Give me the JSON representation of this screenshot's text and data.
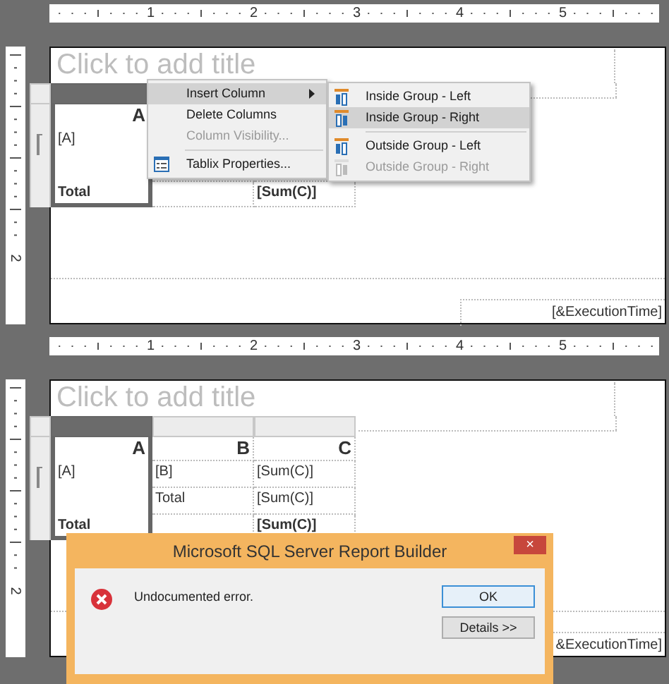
{
  "panels": [
    {
      "ruler": {
        "labels": [
          "1",
          "2",
          "3",
          "4",
          "5"
        ]
      },
      "side_ruler": {
        "labels": [
          "2"
        ]
      },
      "title_placeholder": "Click to add title",
      "tablix": {
        "columns": [
          {
            "kind": "column",
            "selected": true
          },
          {
            "kind": "covered"
          },
          {
            "kind": "covered"
          }
        ],
        "rows": [
          {
            "kind": "header",
            "cells": [
              "A",
              null,
              null
            ]
          },
          {
            "kind": "detail",
            "cells": [
              "[A]",
              null,
              null
            ]
          },
          {
            "kind": "detail",
            "cells": [
              null,
              null,
              null
            ]
          },
          {
            "kind": "total",
            "cells": [
              "Total",
              null,
              "[Sum(C)]"
            ]
          }
        ]
      },
      "footer": "[&ExecutionTime]",
      "context_menu": {
        "items": [
          {
            "kind": "item",
            "label": "Insert Column",
            "selected": true,
            "disabled": false,
            "submenu": true
          },
          {
            "kind": "item",
            "label": "Delete Columns",
            "selected": false,
            "disabled": false,
            "submenu": false
          },
          {
            "kind": "item",
            "label": "Column Visibility...",
            "selected": false,
            "disabled": true,
            "submenu": false
          },
          {
            "kind": "separator"
          },
          {
            "kind": "item",
            "label": "Tablix Properties...",
            "selected": false,
            "disabled": false,
            "submenu": false
          }
        ],
        "submenu": {
          "items": [
            {
              "kind": "item",
              "label": "Inside Group - Left",
              "selected": false,
              "disabled": false
            },
            {
              "kind": "item",
              "label": "Inside Group - Right",
              "selected": true,
              "disabled": false
            },
            {
              "kind": "separator"
            },
            {
              "kind": "item",
              "label": "Outside Group - Left",
              "selected": false,
              "disabled": false
            },
            {
              "kind": "item",
              "label": "Outside Group - Right",
              "selected": false,
              "disabled": true
            }
          ]
        }
      }
    },
    {
      "ruler": {
        "labels": [
          "1",
          "2",
          "3",
          "4",
          "5"
        ]
      },
      "side_ruler": {
        "labels": [
          "2"
        ]
      },
      "title_placeholder": "Click to add title",
      "tablix": {
        "columns": [
          {
            "kind": "column",
            "selected": true
          },
          {
            "kind": "column",
            "selected": false
          },
          {
            "kind": "column",
            "selected": false
          }
        ],
        "rows": [
          {
            "kind": "header",
            "cells": [
              "A",
              "B",
              "C"
            ]
          },
          {
            "kind": "detail",
            "cells": [
              "[A]",
              "[B]",
              "[Sum(C)]"
            ]
          },
          {
            "kind": "detail",
            "cells": [
              null,
              "Total",
              "[Sum(C)]"
            ]
          },
          {
            "kind": "total",
            "cells": [
              "Total",
              null,
              "[Sum(C)]"
            ]
          }
        ]
      },
      "footer": "&ExecutionTime]",
      "dialog": {
        "title": "Microsoft SQL Server Report Builder",
        "close": "×",
        "message": "Undocumented error.",
        "buttons": [
          {
            "label": "OK",
            "default": true
          },
          {
            "label": "Details >>",
            "default": false
          }
        ]
      }
    }
  ]
}
